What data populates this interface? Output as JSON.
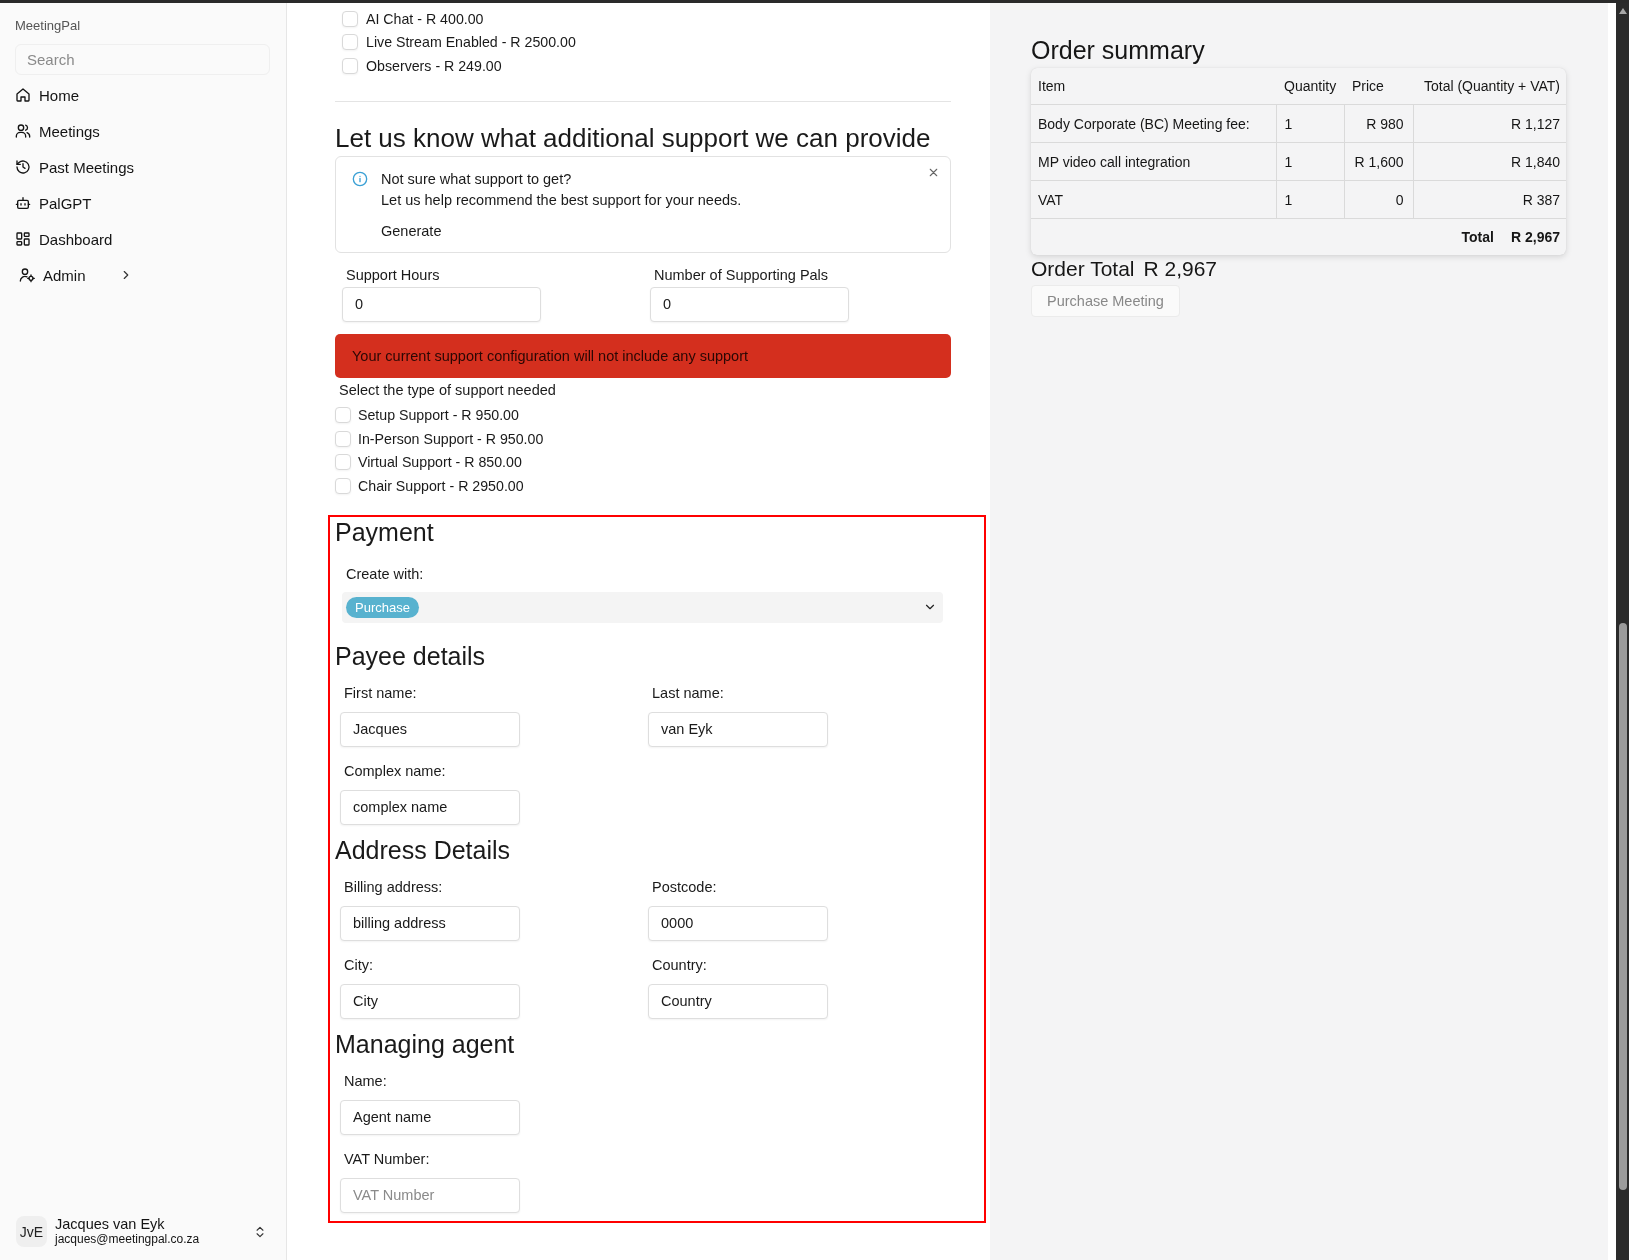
{
  "sidebar": {
    "app_name": "MeetingPal",
    "search": {
      "placeholder": "Search"
    },
    "items": [
      {
        "label": "Home",
        "kind": "link",
        "selected": false
      },
      {
        "label": "Meetings",
        "kind": "link",
        "selected": false
      },
      {
        "label": "Past Meetings",
        "kind": "link",
        "selected": false
      },
      {
        "label": "PalGPT",
        "kind": "link",
        "selected": false
      },
      {
        "label": "Dashboard",
        "kind": "link",
        "selected": false
      },
      {
        "label": "Admin",
        "kind": "group",
        "selected": false,
        "expanded": false
      }
    ],
    "user": {
      "initials": "JvE",
      "name": "Jacques van Eyk",
      "email": "jacques@meetingpal.co.za"
    }
  },
  "add_ons": [
    {
      "label": "AI Chat - R 400.00",
      "checked": false
    },
    {
      "label": "Live Stream Enabled - R 2500.00",
      "checked": false
    },
    {
      "label": "Observers - R 249.00",
      "checked": false
    }
  ],
  "support": {
    "title": "Let us know what additional support we can provide",
    "notice": {
      "title": "Not sure what support to get?",
      "text": "Let us help recommend the best support for your needs.",
      "action": "Generate"
    },
    "fields": [
      {
        "label": "Support Hours",
        "value": "0"
      },
      {
        "label": "Number of Supporting Pals",
        "value": "0"
      }
    ],
    "alert": "Your current support configuration will not include any support",
    "types_label": "Select the type of support needed",
    "types": [
      {
        "label": "Setup Support - R 950.00",
        "checked": false
      },
      {
        "label": "In-Person Support - R 950.00",
        "checked": false
      },
      {
        "label": "Virtual Support - R 850.00",
        "checked": false
      },
      {
        "label": "Chair Support - R 2950.00",
        "checked": false
      }
    ]
  },
  "payment": {
    "title": "Payment",
    "create_with": {
      "label": "Create with:",
      "tags": [
        "Purchase"
      ]
    },
    "sections": [
      {
        "title": "Payee details",
        "rows": [
          [
            {
              "label": "First name:",
              "value": "Jacques"
            },
            {
              "label": "Last name:",
              "value": "van Eyk"
            }
          ],
          [
            {
              "label": "Complex name:",
              "value": "complex name"
            }
          ]
        ]
      },
      {
        "title": "Address Details",
        "rows": [
          [
            {
              "label": "Billing address:",
              "value": "billing address"
            },
            {
              "label": "Postcode:",
              "value": "0000"
            }
          ],
          [
            {
              "label": "City:",
              "value": "City"
            },
            {
              "label": "Country:",
              "value": "Country"
            }
          ]
        ]
      },
      {
        "title": "Managing agent",
        "rows": [
          [
            {
              "label": "Name:",
              "value": "Agent name"
            }
          ],
          [
            {
              "label": "VAT Number:",
              "placeholder": "VAT Number"
            }
          ]
        ]
      }
    ]
  },
  "order_summary": {
    "title": "Order summary",
    "columns": [
      "Item",
      "Quantity",
      "Price",
      "Total (Quantity + VAT)"
    ],
    "rows": [
      [
        "Body Corporate (BC) Meeting fee:",
        "1",
        "R 980",
        "R 1,127"
      ],
      [
        "MP video call integration",
        "1",
        "R 1,600",
        "R 1,840"
      ],
      [
        "VAT",
        "1",
        "0",
        "R 387"
      ]
    ],
    "total": {
      "label": "Total",
      "value": "R 2,967"
    },
    "order_total": {
      "label": "Order Total",
      "value": "R 2,967"
    },
    "purchase_button": {
      "label": "Purchase Meeting",
      "disabled": true
    }
  }
}
